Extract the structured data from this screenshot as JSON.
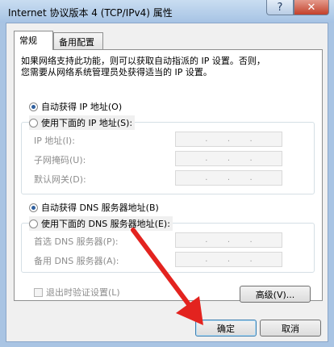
{
  "window": {
    "title": "Internet 协议版本 4 (TCP/IPv4) 属性"
  },
  "titlebar": {
    "help_icon": "?",
    "close_icon": "✕"
  },
  "tabs": [
    {
      "label": "常规"
    },
    {
      "label": "备用配置"
    }
  ],
  "description": [
    "如果网络支持此功能，则可以获取自动指派的 IP 设置。否则，",
    "您需要从网络系统管理员处获得适当的 IP 设置。"
  ],
  "ip": {
    "auto_label": "自动获得 IP 地址(O)",
    "manual_label": "使用下面的 IP 地址(S):",
    "selected": "auto",
    "fields": [
      {
        "label": "IP 地址(I):"
      },
      {
        "label": "子网掩码(U):"
      },
      {
        "label": "默认网关(D):"
      }
    ]
  },
  "dns": {
    "auto_label": "自动获得 DNS 服务器地址(B)",
    "manual_label": "使用下面的 DNS 服务器地址(E):",
    "selected": "auto",
    "fields": [
      {
        "label": "首选 DNS 服务器(P):"
      },
      {
        "label": "备用 DNS 服务器(A):"
      }
    ]
  },
  "validate_on_exit": {
    "label": "退出时验证设置(L)",
    "checked": false
  },
  "buttons": {
    "advanced": "高级(V)...",
    "ok": "确定",
    "cancel": "取消"
  },
  "annotation": {
    "arrow_color": "#e3231f"
  }
}
